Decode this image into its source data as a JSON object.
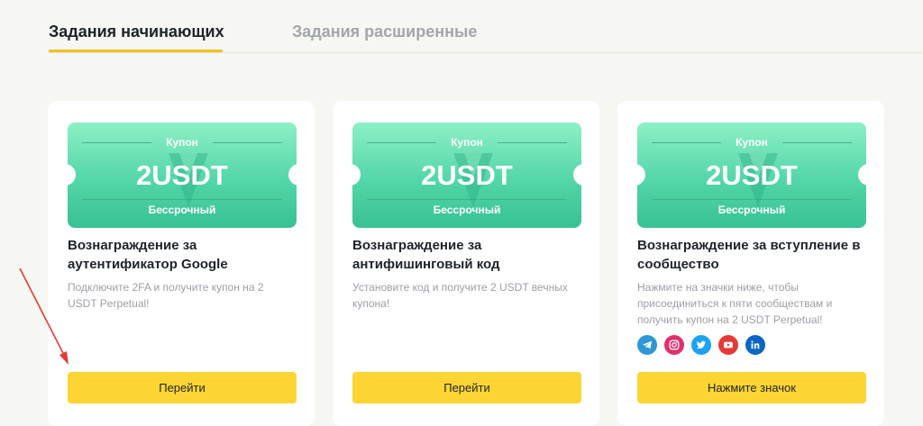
{
  "tabs": {
    "active": "Задания начинающих",
    "inactive": "Задания расширенные"
  },
  "colors": {
    "accent": "#f0c11a",
    "button": "#fcd535",
    "coupon_green": "#53d6a8",
    "annotation_arrow": "#e53935"
  },
  "cards": [
    {
      "coupon": {
        "label": "Купон",
        "amount": "2USDT",
        "term": "Бессрочный"
      },
      "title": "Вознаграждение за аутентификатор Google",
      "description": "Подключите 2FA и получите купон на 2 USDT Perpetual!",
      "button": "Перейти"
    },
    {
      "coupon": {
        "label": "Купон",
        "amount": "2USDT",
        "term": "Бессрочный"
      },
      "title": "Вознаграждение за антифишинговый код",
      "description": "Установите код и получите 2 USDT вечных купона!",
      "button": "Перейти"
    },
    {
      "coupon": {
        "label": "Купон",
        "amount": "2USDT",
        "term": "Бессрочный"
      },
      "title": "Вознаграждение за вступление в сообщество",
      "description": "Нажмите на значки ниже, чтобы присоединиться к пяти сообществам и получить купон на 2 USDT Perpetual!",
      "socials": [
        "telegram-icon",
        "instagram-icon",
        "twitter-icon",
        "youtube-icon",
        "linkedin-icon"
      ],
      "button": "Нажмите значок"
    }
  ]
}
